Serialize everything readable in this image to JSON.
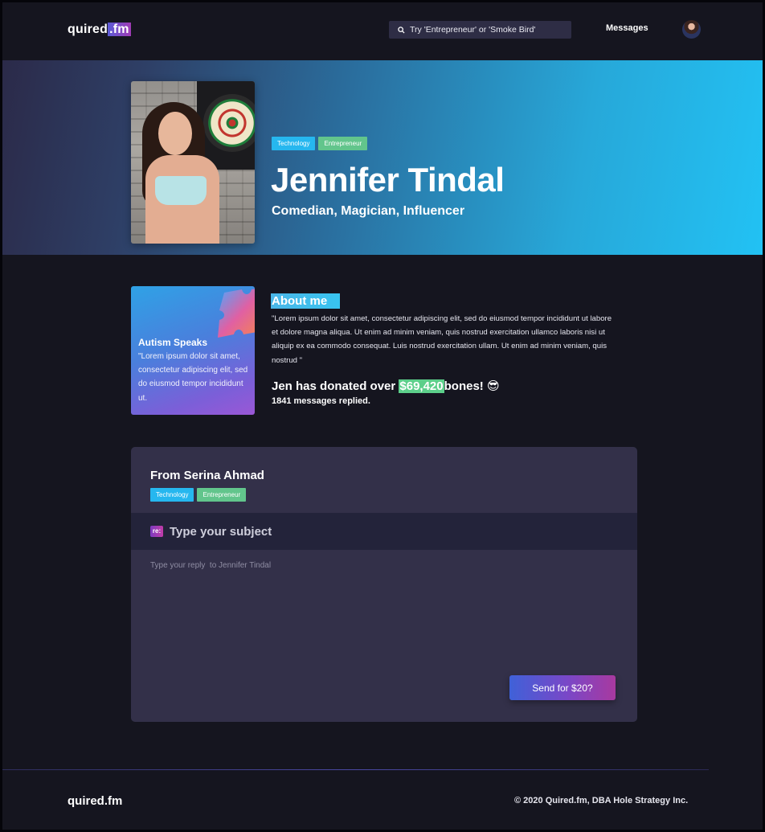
{
  "header": {
    "logo_prefix": "quired",
    "logo_suffix": ".fm",
    "search_placeholder": "Try 'Entrepreneur' or 'Smoke Bird'",
    "nav_messages": "Messages",
    "search_icon": "search-icon"
  },
  "profile": {
    "tags": [
      "Technology",
      "Entrepreneur"
    ],
    "name": "Jennifer Tindal",
    "subtitle": "Comedian, Magician, Influencer"
  },
  "charity": {
    "title": "Autism Speaks",
    "text": "\"Lorem ipsum dolor sit amet, consectetur adipiscing elit, sed do eiusmod tempor incididunt ut."
  },
  "about": {
    "heading": "About me",
    "text": "\"Lorem ipsum dolor sit amet, consectetur adipiscing elit, sed do eiusmod tempor incididunt ut labore et dolore magna aliqua. Ut enim ad minim veniam, quis nostrud exercitation ullamco laboris nisi ut aliquip ex ea commodo consequat.  Luis nostrud exercitation ullam.  Ut enim ad minim veniam, quis nostrud \"",
    "donation_prefix": "Jen has donated over",
    "donation_amount": "$69,420",
    "donation_suffix": "bones!",
    "donation_emoji": "😎",
    "messages_replied": "1841 messages replied."
  },
  "composer": {
    "from": "From Serina Ahmad",
    "tags": [
      "Technology",
      "Entrepreneur"
    ],
    "re_badge": "re:",
    "subject_placeholder": "Type your subject",
    "reply_placeholder": "Type your reply  to Jennifer Tindal",
    "send_label": "Send for $20?"
  },
  "footer": {
    "logo": "quired.fm",
    "copyright": "© 2020 Quired.fm, DBA Hole Strategy Inc."
  },
  "colors": {
    "background": "#15151f",
    "tag_technology": "#26b7ef",
    "tag_entrepreneur": "#62c58c",
    "composer_bg": "#333049",
    "accent_purple": "#a03bb5"
  }
}
